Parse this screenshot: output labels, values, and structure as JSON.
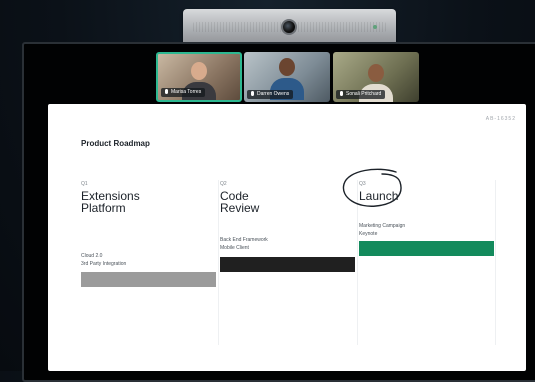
{
  "participants": [
    {
      "name": "Marisa Torres",
      "active": true
    },
    {
      "name": "Darren Owens",
      "active": false
    },
    {
      "name": "Sonali Pritchard",
      "active": false
    }
  ],
  "board": {
    "id": "AB-16352",
    "title": "Product Roadmap",
    "columns": [
      {
        "label": "Q1",
        "heading": "Extensions\nPlatform",
        "items": "Cloud 2.0\n3rd Party Integration",
        "bar_color": "#9b9b9b"
      },
      {
        "label": "Q2",
        "heading": "Code\nReview",
        "items": "Back End Framework\nMobile Client",
        "bar_color": "#202020"
      },
      {
        "label": "Q3",
        "heading": "Launch",
        "items": "Marketing Campaign\nKeynote",
        "bar_color": "#138a5c",
        "circled": true
      }
    ]
  },
  "colors": {
    "active_speaker": "#2db891",
    "accent_green": "#138a5c"
  }
}
